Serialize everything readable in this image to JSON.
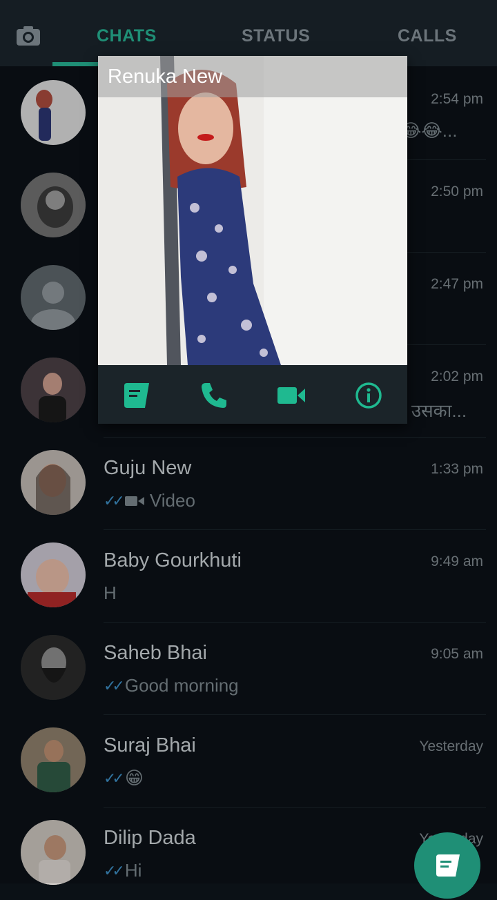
{
  "tabs": {
    "chats": "CHATS",
    "status": "STATUS",
    "calls": "CALLS"
  },
  "chats": [
    {
      "name": "",
      "time": "2:54 pm",
      "preview": "😂😂..."
    },
    {
      "name": "",
      "time": "2:50 pm",
      "preview": ""
    },
    {
      "name": "",
      "time": "2:47 pm",
      "preview": ""
    },
    {
      "name": "",
      "time": "2:02 pm",
      "preview": "र उसका..."
    },
    {
      "name": "Guju New",
      "time": "1:33 pm",
      "preview": "Video"
    },
    {
      "name": "Baby Gourkhuti",
      "time": "9:49 am",
      "preview": "H"
    },
    {
      "name": "Saheb Bhai",
      "time": "9:05 am",
      "preview": "Good morning"
    },
    {
      "name": "Suraj Bhai",
      "time": "Yesterday",
      "preview": "😁"
    },
    {
      "name": "Dilip Dada",
      "time": "Yesterday",
      "preview": "Hi"
    }
  ],
  "popup": {
    "contact_name": "Renuka New"
  },
  "colors": {
    "accent": "#1f8f76",
    "background": "#0b1116",
    "read_ticks": "#3c8cc1"
  },
  "icons": [
    "camera-icon",
    "message-icon",
    "phone-icon",
    "video-call-icon",
    "info-icon",
    "video-icon",
    "new-chat-icon"
  ]
}
